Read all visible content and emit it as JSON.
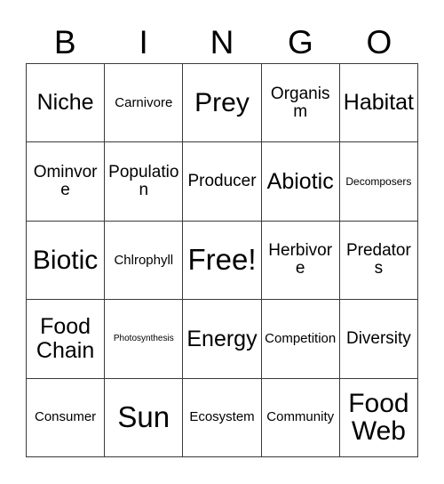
{
  "card": {
    "title": "BINGO",
    "header_letters": [
      "B",
      "I",
      "N",
      "G",
      "O"
    ],
    "colors": {
      "background": "#ffffff",
      "text": "#000000",
      "grid_line": "#3a3a3a"
    },
    "grid": {
      "rows": 5,
      "columns": 5,
      "free_space_index": 12
    },
    "cells": [
      {
        "text": "Niche",
        "size": "lg"
      },
      {
        "text": "Carnivore",
        "size": "sm"
      },
      {
        "text": "Prey",
        "size": "xl"
      },
      {
        "text": "Organism",
        "size": "md"
      },
      {
        "text": "Habitat",
        "size": "lg"
      },
      {
        "text": "Ominvore",
        "size": "md"
      },
      {
        "text": "Population",
        "size": "md"
      },
      {
        "text": "Producer",
        "size": "md"
      },
      {
        "text": "Abiotic",
        "size": "lg"
      },
      {
        "text": "Decomposers",
        "size": "xs"
      },
      {
        "text": "Biotic",
        "size": "xl"
      },
      {
        "text": "Chlrophyll",
        "size": "sm"
      },
      {
        "text": "Free!",
        "size": "xxl"
      },
      {
        "text": "Herbivore",
        "size": "md"
      },
      {
        "text": "Predators",
        "size": "md"
      },
      {
        "text": "Food Chain",
        "size": "lg"
      },
      {
        "text": "Photosynthesis",
        "size": "xxs"
      },
      {
        "text": "Energy",
        "size": "lg"
      },
      {
        "text": "Competition",
        "size": "sm"
      },
      {
        "text": "Diversity",
        "size": "md"
      },
      {
        "text": "Consumer",
        "size": "sm"
      },
      {
        "text": "Sun",
        "size": "xxl"
      },
      {
        "text": "Ecosystem",
        "size": "sm"
      },
      {
        "text": "Community",
        "size": "sm"
      },
      {
        "text": "Food Web",
        "size": "xl"
      }
    ]
  }
}
